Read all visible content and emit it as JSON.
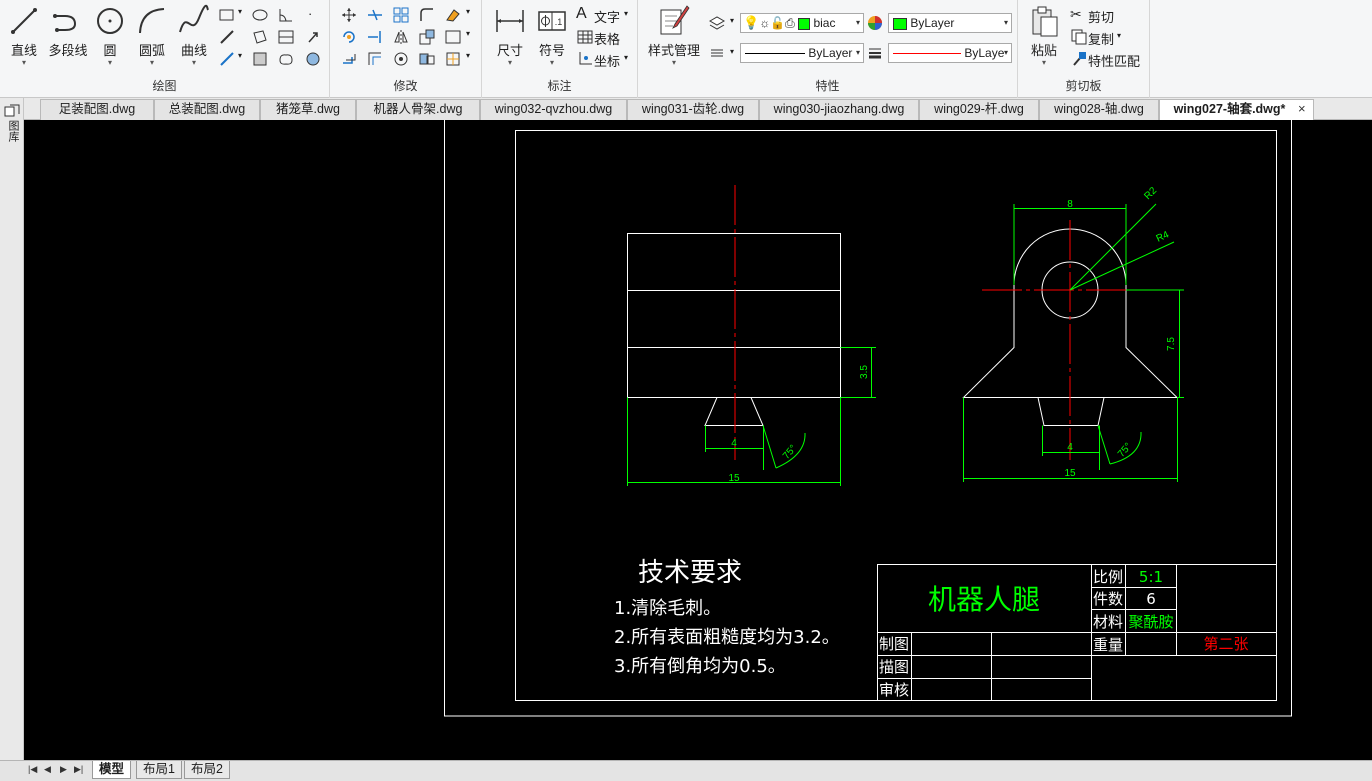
{
  "ribbon": {
    "draw": {
      "title": "绘图",
      "line": "直线",
      "polyline": "多段线",
      "circle": "圆",
      "arc": "圆弧",
      "curve": "曲线"
    },
    "modify": {
      "title": "修改"
    },
    "annotate": {
      "title": "标注",
      "dimension": "尺寸",
      "symbol": "符号",
      "text": "文字",
      "table": "表格",
      "coordinate": "坐标"
    },
    "properties": {
      "title": "特性",
      "style_manager": "样式管理",
      "layer_name": "biac",
      "color": "ByLayer",
      "linetype": "ByLayer",
      "lineweight": "ByLaye",
      "accent_color": "#00ff00",
      "lineweight_color": "#ff0000"
    },
    "clipboard": {
      "title": "剪切板",
      "paste": "粘贴",
      "cut": "剪切",
      "copy": "复制",
      "match": "特性匹配"
    }
  },
  "tabs": [
    {
      "label": "足装配图.dwg",
      "active": false
    },
    {
      "label": "总装配图.dwg",
      "active": false
    },
    {
      "label": "猪笼草.dwg",
      "active": false
    },
    {
      "label": "机器人骨架.dwg",
      "active": false
    },
    {
      "label": "wing032-qvzhou.dwg",
      "active": false
    },
    {
      "label": "wing031-齿轮.dwg",
      "active": false
    },
    {
      "label": "wing030-jiaozhang.dwg",
      "active": false
    },
    {
      "label": "wing029-杆.dwg",
      "active": false
    },
    {
      "label": "wing028-轴.dwg",
      "active": false
    },
    {
      "label": "wing027-轴套.dwg*",
      "active": true
    }
  ],
  "tab_close": "×",
  "left_toolbar_label": "图库",
  "drawing": {
    "dims": {
      "left_height": "3.5",
      "left_width": "15",
      "left_slot": "4",
      "left_angle": "75°",
      "right_width": "8",
      "right_r_outer": "R2",
      "right_r_inner": "R4",
      "right_height": "7.5",
      "right_slot": "4",
      "right_angle": "75°",
      "right_total": "15"
    },
    "requirements": {
      "heading": "技术要求",
      "item1": "1.清除毛刺。",
      "item2": "2.所有表面粗糙度均为3.2。",
      "item3": "3.所有倒角均为0.5。"
    },
    "title_block": {
      "part_name": "机器人腿",
      "scale_label": "比例",
      "scale_value": "5:1",
      "count_label": "件数",
      "count_value": "6",
      "material_label": "材料",
      "material_value": "聚酰胺",
      "weight_label": "重量",
      "sheet": "第二张",
      "drawn_label": "制图",
      "traced_label": "描图",
      "checked_label": "审核"
    },
    "colors": {
      "outline": "#ffffff",
      "center": "#ff0000",
      "dimension": "#00ff00",
      "sheet_text": "#ff0000"
    }
  },
  "layout_tabs": {
    "model": "模型",
    "layout1": "布局1",
    "layout2": "布局2"
  }
}
